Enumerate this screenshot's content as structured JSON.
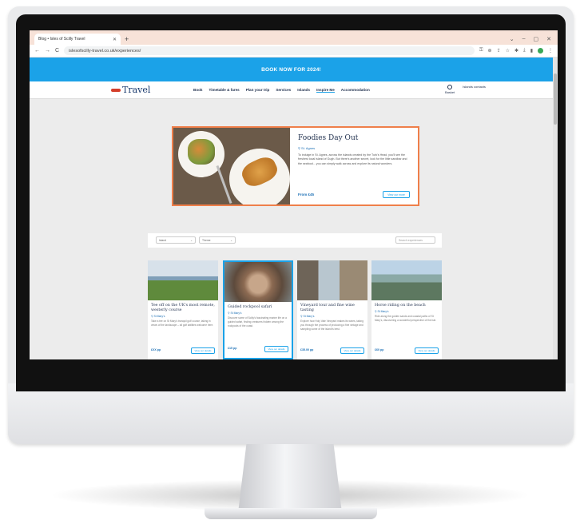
{
  "browser": {
    "tab_title": "Blog • Isles of Scilly Travel",
    "tab_close": "✕",
    "new_tab": "+",
    "url": "islesofscilly-travel.co.uk/experiences/",
    "back": "←",
    "forward": "→",
    "reload": "C",
    "window_controls": [
      "⌄",
      "–",
      "▢",
      "✕"
    ]
  },
  "site": {
    "promo_banner": "BOOK NOW FOR 2024!",
    "logo_text": "Travel",
    "nav_items": [
      "Book",
      "Timetable & fares",
      "Plan your trip",
      "Services",
      "Islands",
      "Inspire Me",
      "Accommodation"
    ],
    "nav_active": "Inspire Me",
    "nav_right": [
      "Basket",
      "Islands contacts"
    ]
  },
  "featured": {
    "title": "Foodies Day Out",
    "location": "St. Agnes",
    "description": "To indulge in St. Agnes, across the islands created by the Turk's Head, you'll see the freshest local island of Gugh. But there's another secret, look for the little sandbar and the seafood... you can simply walk across and explore its natural wonders.",
    "price": "From £45",
    "button": "View our more"
  },
  "filters": {
    "select_1": "Island",
    "select_2": "Theme",
    "search_placeholder": "Search experiences"
  },
  "cards": [
    {
      "title": "Tee off on the UK's most remote, westerly course",
      "location": "St Mary's",
      "description": "Take a tee on St Mary's tranquil golf course, taking in views of the landscape – all golf abilities welcome here.",
      "price": "£XX pp",
      "button": "View our details"
    },
    {
      "title": "Guided rockpool safari",
      "location": "St Mary's",
      "description": "Discover some of Scilly's fascinating marine life on a guided safari, finding creatures hidden among the rockpools of the coast.",
      "price": "£15 pp",
      "button": "View our details"
    },
    {
      "title": "Vineyard tour and fine wine tasting",
      "location": "St Mary's",
      "description": "Explore how Holy Vale Vineyard makes its wines, taking you through the process of producing a fine vintage and sampling some of the island's best.",
      "price": "£35.00 pp",
      "button": "View our details"
    },
    {
      "title": "Horse riding on the beach",
      "location": "St Mary's",
      "description": "Ride along the golden sands and coastal paths of St Mary's, discovering a wonderful perspective of the isle.",
      "price": "£60 pp",
      "button": "View our details"
    }
  ]
}
